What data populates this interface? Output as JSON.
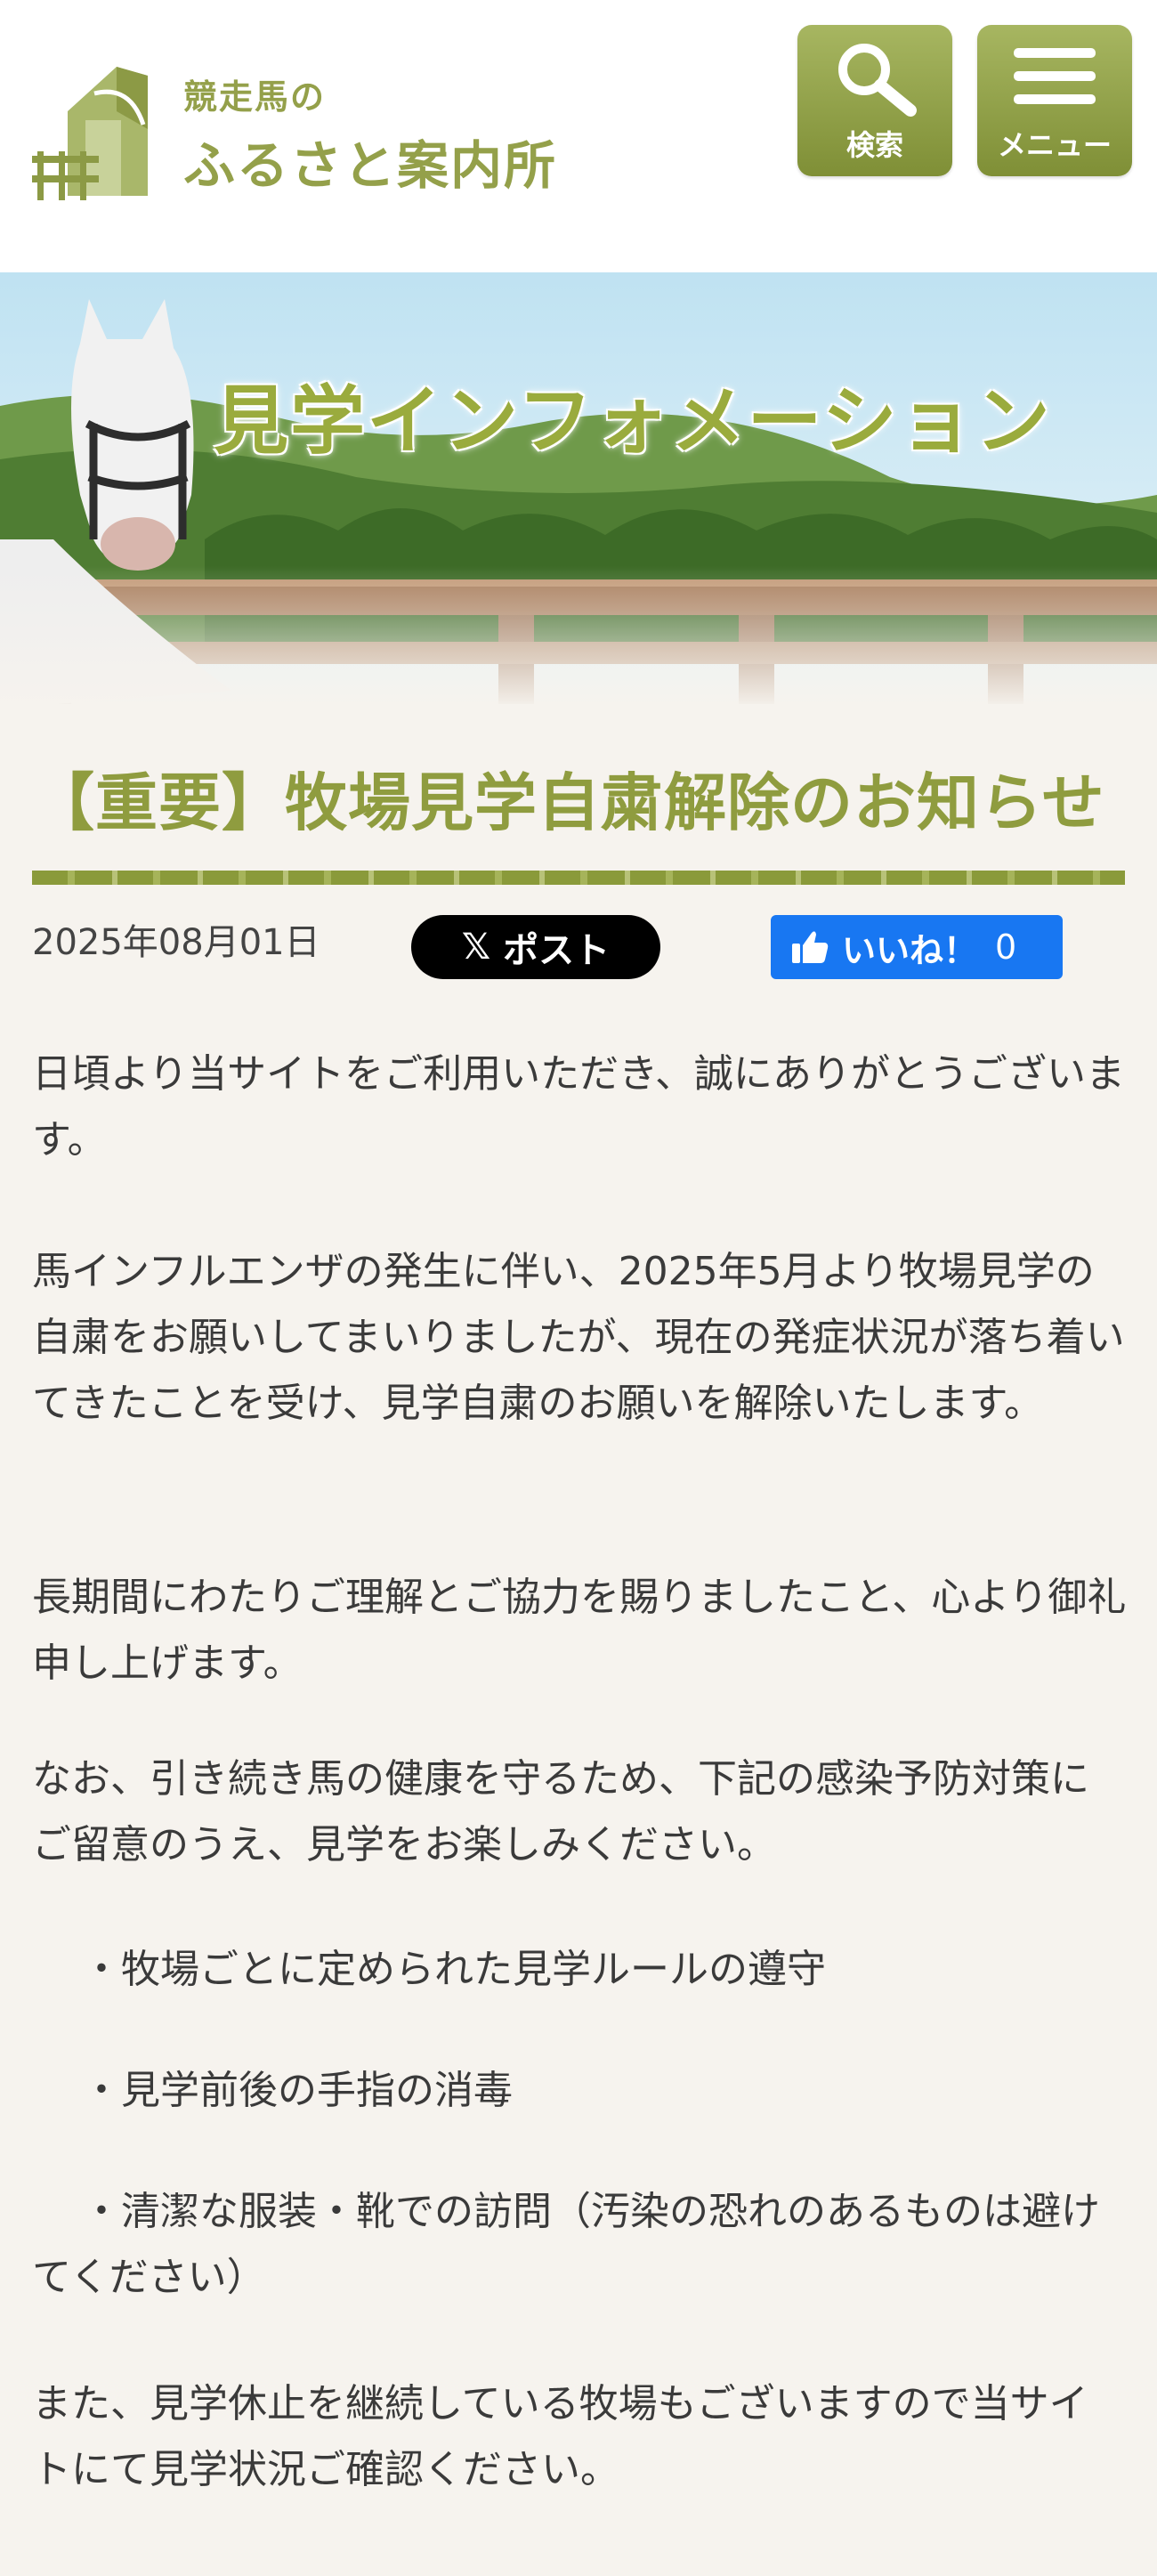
{
  "header": {
    "logo_small": "競走馬の",
    "logo_big": "ふるさと案内所",
    "search_label": "検索",
    "menu_label": "メニュー"
  },
  "hero": {
    "title": "見学インフォメーション"
  },
  "article": {
    "title": "【重要】牧場見学自粛解除のお知らせ",
    "date": "2025年08月01日",
    "share": {
      "x_label": "ポスト",
      "fb_label": "いいね！",
      "fb_count": "0"
    },
    "paragraphs": [
      "日頃より当サイトをご利用いただき、誠にありがとうございます。",
      "馬インフルエンザの発生に伴い、2025年5月より牧場見学の自粛をお願いしてまいりましたが、現在の発症状況が落ち着いてきたことを受け、見学自粛のお願いを解除いたします。",
      "長期間にわたりご理解とご協力を賜りましたこと、心より御礼申し上げます。",
      "なお、引き続き馬の健康を守るため、下記の感染予防対策にご留意のうえ、見学をお楽しみください。",
      "・牧場ごとに定められた見学ルールの遵守",
      "・見学前後の手指の消毒",
      "・清潔な服装・靴での訪問（汚染の恐れのあるものは避けてください）",
      "また、見学休止を継続している牧場もございますので当サイトにて見学状況ご確認ください。"
    ]
  },
  "colors": {
    "accent": "#8f9c3f",
    "button": "#95a44b",
    "background": "#f6f3ee",
    "fb_blue": "#1877f2"
  }
}
